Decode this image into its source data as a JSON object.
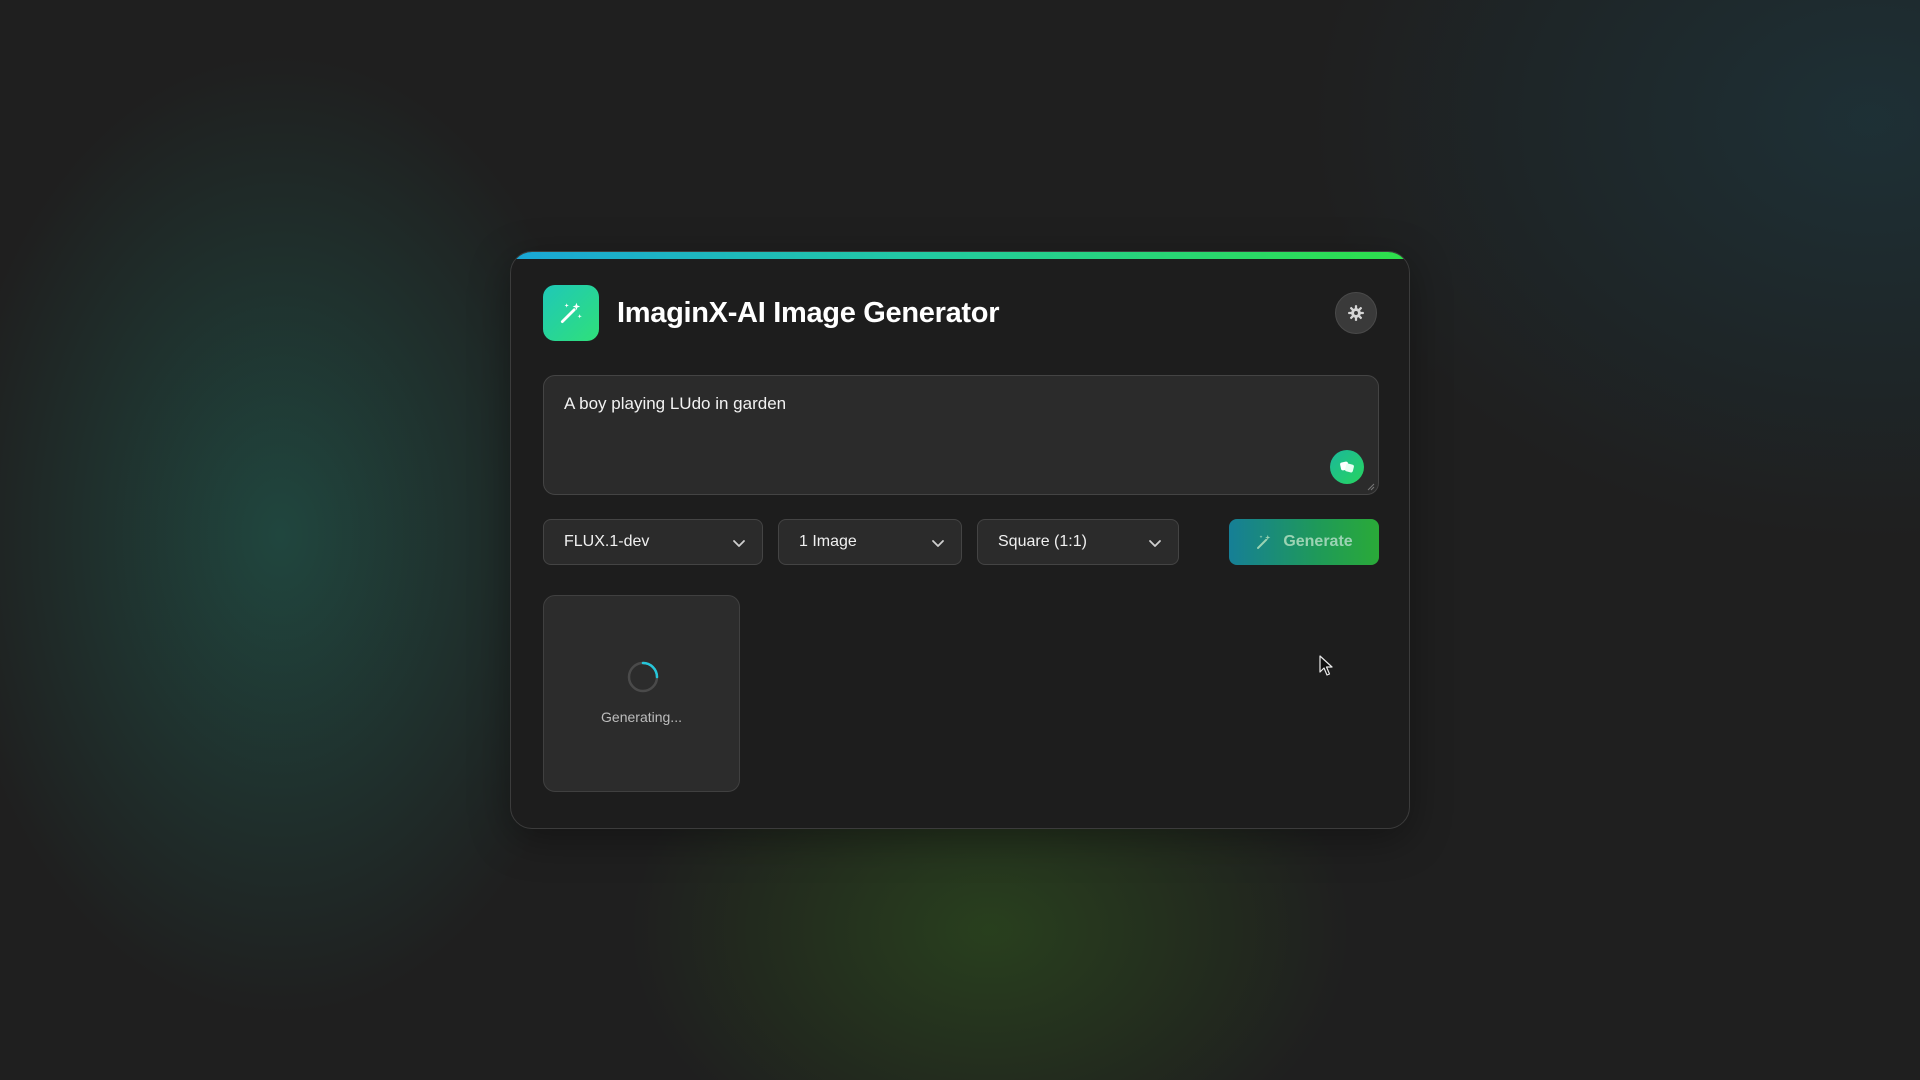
{
  "app": {
    "title": "ImaginX-AI Image Generator",
    "logo_icon": "magic-wand-icon",
    "theme_icon": "gear-icon",
    "accent_gradient": [
      "#1aa6d6",
      "#22c9a3",
      "#2ee04a"
    ]
  },
  "prompt": {
    "value": "A boy playing LUdo in garden",
    "placeholder": "",
    "dice_icon": "dice-icon"
  },
  "controls": {
    "model": {
      "selected": "FLUX.1-dev"
    },
    "count": {
      "selected": "1 Image"
    },
    "ratio": {
      "selected": "Square (1:1)"
    },
    "generate": {
      "label": "Generate",
      "icon": "magic-wand-icon"
    }
  },
  "gallery": {
    "items": [
      {
        "status_text": "Generating...",
        "icon": "spinner-icon"
      }
    ]
  }
}
